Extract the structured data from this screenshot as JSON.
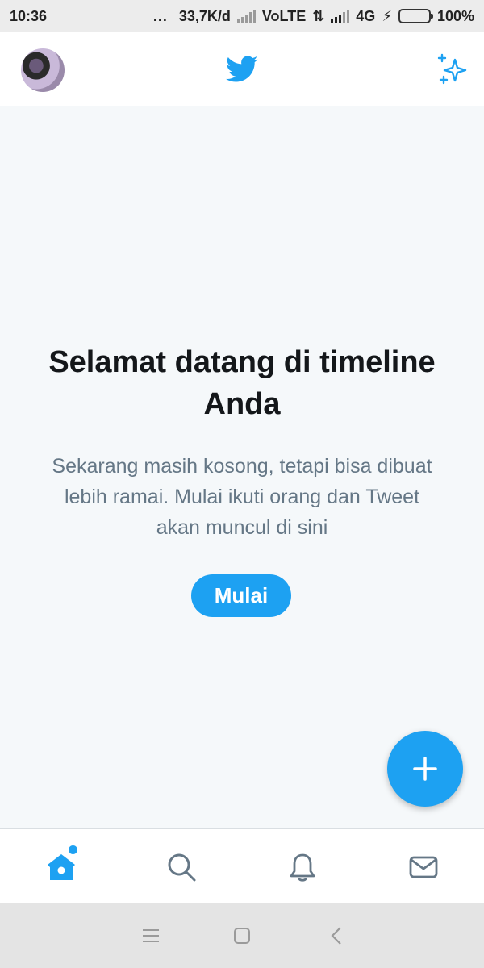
{
  "status_bar": {
    "time": "10:36",
    "dots": "...",
    "network_speed": "33,7K/d",
    "network_type_1": "VoLTE",
    "network_type_2": "4G",
    "battery": "100%"
  },
  "header": {
    "logo_icon": "twitter-bird-icon",
    "action_icon": "sparkle-icon",
    "avatar": "user-avatar"
  },
  "main": {
    "title": "Selamat datang di timeline Anda",
    "description": "Sekarang masih kosong, tetapi bisa dibuat lebih ramai. Mulai ikuti orang dan Tweet akan muncul di sini",
    "start_button": "Mulai",
    "compose_icon": "plus-icon"
  },
  "tabs": [
    {
      "icon": "home-icon",
      "active": true,
      "has_dot": true
    },
    {
      "icon": "search-icon",
      "active": false
    },
    {
      "icon": "bell-icon",
      "active": false
    },
    {
      "icon": "mail-icon",
      "active": false
    }
  ],
  "colors": {
    "accent": "#1da1f2",
    "background": "#f5f8fa",
    "title_text": "#14171a",
    "secondary_text": "#657786",
    "inactive_icon": "#657786"
  }
}
